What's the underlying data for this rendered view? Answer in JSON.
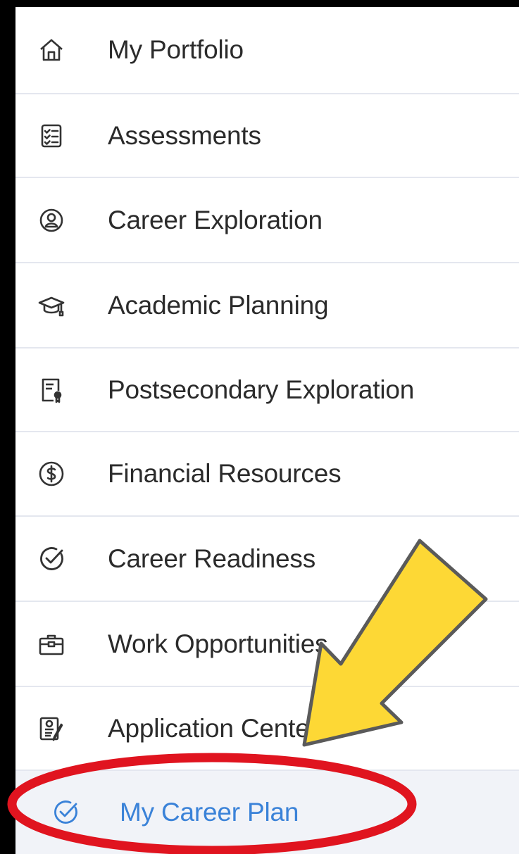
{
  "nav": {
    "items": [
      {
        "label": "My Portfolio",
        "icon": "home-icon"
      },
      {
        "label": "Assessments",
        "icon": "checklist-icon"
      },
      {
        "label": "Career Exploration",
        "icon": "person-badge-icon"
      },
      {
        "label": "Academic Planning",
        "icon": "graduation-cap-icon"
      },
      {
        "label": "Postsecondary Exploration",
        "icon": "certificate-icon"
      },
      {
        "label": "Financial Resources",
        "icon": "dollar-circle-icon"
      },
      {
        "label": "Career Readiness",
        "icon": "check-circle-icon"
      },
      {
        "label": "Work Opportunities",
        "icon": "briefcase-icon"
      },
      {
        "label": "Application Center",
        "icon": "application-icon"
      },
      {
        "label": "My Career Plan",
        "icon": "check-circle-icon",
        "active": true
      }
    ]
  },
  "colors": {
    "active_text": "#3a82d8",
    "annotation_arrow": "#fdd835",
    "annotation_circle": "#e0141f"
  }
}
